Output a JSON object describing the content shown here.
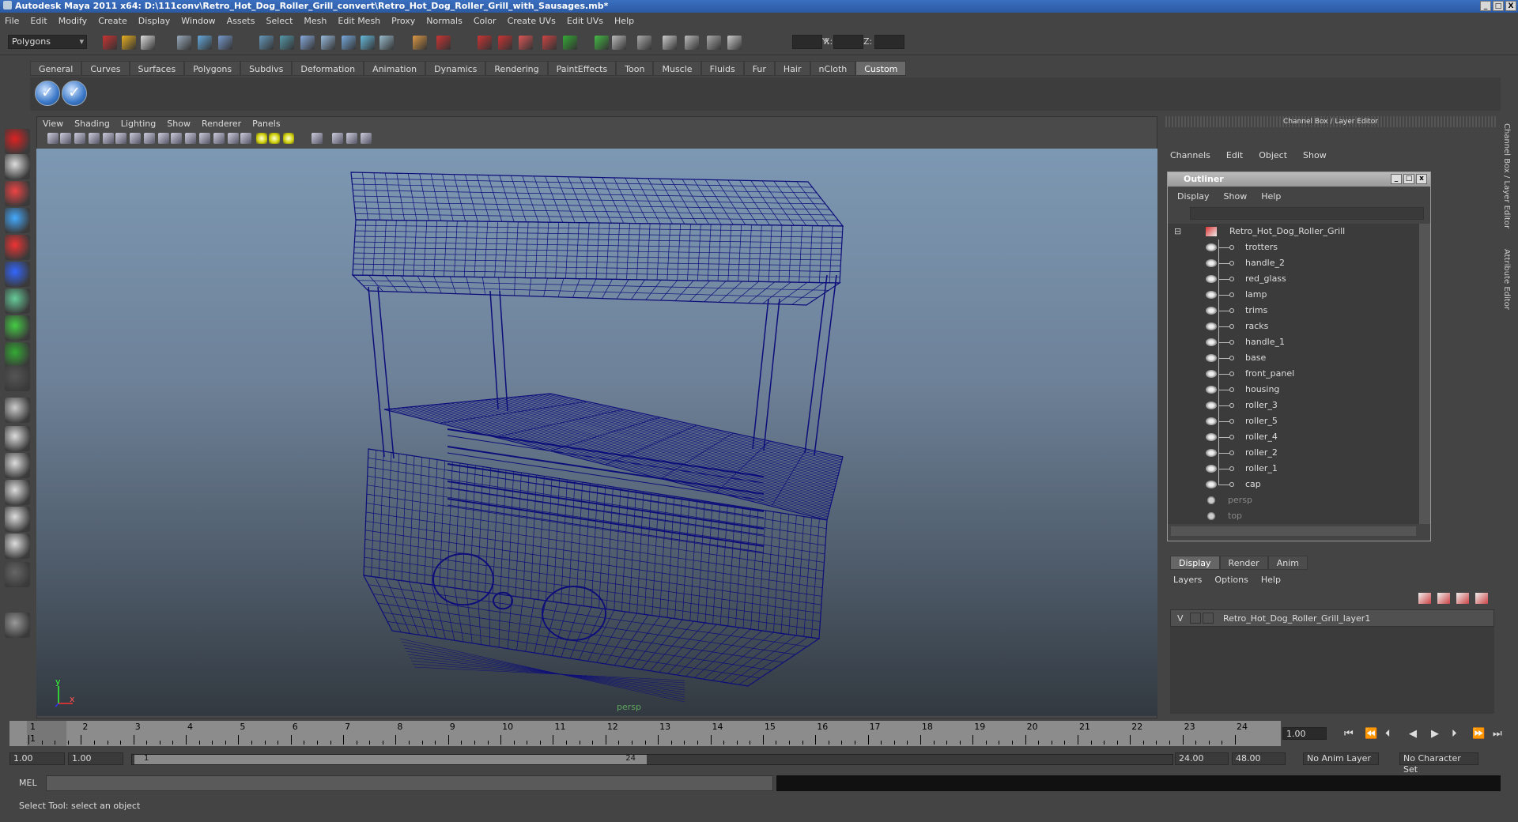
{
  "window": {
    "title": "Autodesk Maya 2011 x64: D:\\111conv\\Retro_Hot_Dog_Roller_Grill_convert\\Retro_Hot_Dog_Roller_Grill_with_Sausages.mb*",
    "controls": [
      "_",
      "□",
      "X"
    ]
  },
  "menubar": [
    "File",
    "Edit",
    "Modify",
    "Create",
    "Display",
    "Window",
    "Assets",
    "Select",
    "Mesh",
    "Edit Mesh",
    "Proxy",
    "Normals",
    "Color",
    "Create UVs",
    "Edit UVs",
    "Help"
  ],
  "statusline": {
    "mode": "Polygons",
    "x_label": "X:",
    "y_label": "Y:",
    "z_label": "Z:"
  },
  "shelf": {
    "tabs": [
      "General",
      "Curves",
      "Surfaces",
      "Polygons",
      "Subdivs",
      "Deformation",
      "Animation",
      "Dynamics",
      "Rendering",
      "PaintEffects",
      "Toon",
      "Muscle",
      "Fluids",
      "Fur",
      "Hair",
      "nCloth",
      "Custom"
    ],
    "active_tab": "Custom"
  },
  "viewport": {
    "menu": [
      "View",
      "Shading",
      "Lighting",
      "Show",
      "Renderer",
      "Panels"
    ],
    "camera_label": "persp",
    "axis_y": "y",
    "axis_x": "x",
    "wire_color": "#0d0d7a"
  },
  "channel_box": {
    "title": "Channel Box / Layer Editor",
    "menu": [
      "Channels",
      "Edit",
      "Object",
      "Show"
    ],
    "side_tabs": [
      "Channel Box / Layer Editor",
      "Attribute Editor"
    ]
  },
  "outliner": {
    "title": "Outliner",
    "menu": [
      "Display",
      "Show",
      "Help"
    ],
    "root": "Retro_Hot_Dog_Roller_Grill",
    "children": [
      "trotters",
      "handle_2",
      "red_glass",
      "lamp",
      "trims",
      "racks",
      "handle_1",
      "base",
      "front_panel",
      "housing",
      "roller_3",
      "roller_5",
      "roller_4",
      "roller_2",
      "roller_1",
      "cap"
    ],
    "cameras": [
      "persp",
      "top"
    ]
  },
  "layer_editor": {
    "tabs": [
      "Display",
      "Render",
      "Anim"
    ],
    "active_tab": "Display",
    "menu": [
      "Layers",
      "Options",
      "Help"
    ],
    "layers": [
      {
        "visible": "V",
        "name": "Retro_Hot_Dog_Roller_Grill_layer1"
      }
    ]
  },
  "timeline": {
    "start": "1",
    "ticks": [
      "1",
      "2",
      "3",
      "4",
      "5",
      "6",
      "7",
      "8",
      "9",
      "10",
      "11",
      "12",
      "13",
      "14",
      "15",
      "16",
      "17",
      "18",
      "19",
      "20",
      "21",
      "22",
      "23",
      "24"
    ],
    "current_frame": "1.00"
  },
  "range": {
    "start_time": "1.00",
    "playback_start": "1.00",
    "slider_start": "1",
    "slider_end": "24",
    "playback_end": "24.00",
    "end_time": "48.00",
    "anim_layer": "No Anim Layer",
    "character_set": "No Character Set"
  },
  "command": {
    "label": "MEL",
    "input": "",
    "output": ""
  },
  "help_line": "Select Tool: select an object"
}
